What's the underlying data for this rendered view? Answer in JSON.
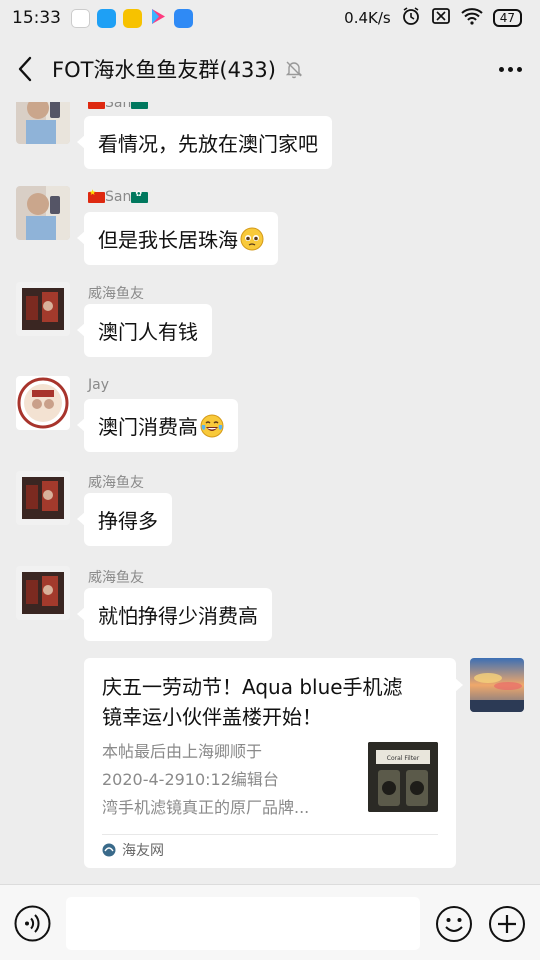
{
  "status_bar": {
    "time": "15:33",
    "network_speed": "0.4K/s",
    "battery": "47",
    "app_icons": [
      "calendar-app-icon",
      "blue-app-icon",
      "yellow-app-icon",
      "video-play-icon",
      "blue-app-icon-2"
    ]
  },
  "header": {
    "back_icon": "chevron-left-icon",
    "title": "FOT海水鱼鱼友群(433)",
    "mute_icon": "bell-off-icon",
    "more_icon": "more-dots-icon"
  },
  "messages": [
    {
      "sender": "San",
      "sender_flags": [
        "china-flag",
        "macau-flag"
      ],
      "text": "看情况，先放在澳门家吧",
      "emoji": ""
    },
    {
      "sender": "San",
      "sender_flags": [
        "china-flag",
        "macau-flag"
      ],
      "text": "但是我长居珠海",
      "emoji": "pleading-face-emoji"
    },
    {
      "sender": "威海鱼友",
      "text": "澳门人有钱",
      "emoji": ""
    },
    {
      "sender": "Jay",
      "text": "澳门消费高",
      "emoji": "tears-of-joy-emoji"
    },
    {
      "sender": "威海鱼友",
      "text": "挣得多",
      "emoji": ""
    },
    {
      "sender": "威海鱼友",
      "text": "就怕挣得少消费高",
      "emoji": ""
    }
  ],
  "link_card": {
    "title_line1": "庆五一劳动节！Aqua blue手机滤",
    "title_line2": "镜幸运小伙伴盖楼开始！",
    "desc_line1": "本帖最后由上海卿顺于",
    "desc_line2": "2020-4-2910:12编辑台",
    "desc_line3": "湾手机滤镜真正的原厂品牌...",
    "thumbnail_label": "Coral Filter",
    "source": "海友网"
  },
  "input_bar": {
    "voice_icon": "voice-icon",
    "emoji_icon": "smiley-icon",
    "plus_icon": "plus-circle-icon"
  },
  "colors": {
    "background": "#ededed",
    "bubble": "#ffffff",
    "sender_text": "#8a8a8a"
  }
}
